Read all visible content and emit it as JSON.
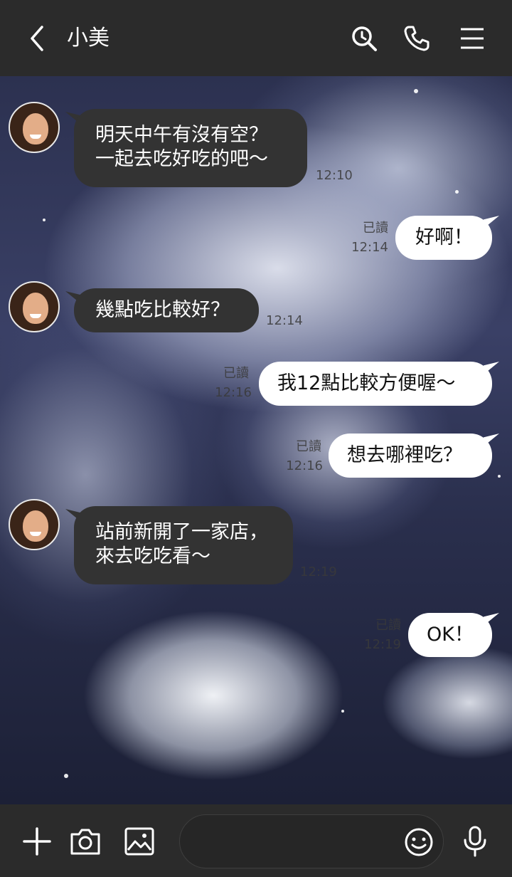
{
  "header": {
    "back_icon": "chevron-left-icon",
    "title": "小美",
    "search_icon": "search-icon",
    "call_icon": "phone-icon",
    "menu_icon": "menu-icon"
  },
  "messages": [
    {
      "side": "in",
      "text": "明天中午有沒有空？\n一起去吃好吃的吧～",
      "time": "12:10"
    },
    {
      "side": "out",
      "text": "好啊！",
      "read": "已讀",
      "time": "12:14"
    },
    {
      "side": "in",
      "text": "幾點吃比較好？",
      "time": "12:14"
    },
    {
      "side": "out",
      "text": "我12點比較方便喔～",
      "read": "已讀",
      "time": "12:16"
    },
    {
      "side": "out",
      "text": "想去哪裡吃？",
      "read": "已讀",
      "time": "12:16"
    },
    {
      "side": "in",
      "text": "站前新開了一家店，\n來去吃吃看～",
      "time": "12:19"
    },
    {
      "side": "out",
      "text": "OK！",
      "read": "已讀",
      "time": "12:19"
    }
  ],
  "bottom_bar": {
    "plus_icon": "plus-icon",
    "camera_icon": "camera-icon",
    "image_icon": "image-icon",
    "input_placeholder": "",
    "emoji_icon": "emoji-icon",
    "mic_icon": "microphone-icon"
  },
  "colors": {
    "bar_bg": "#2b2b2b",
    "incoming_bubble": "#333333",
    "outgoing_bubble": "#ffffff"
  }
}
